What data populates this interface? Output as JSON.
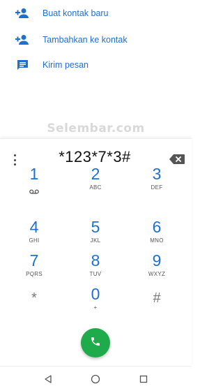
{
  "quick_actions": [
    {
      "label": "Buat kontak baru",
      "icon": "add-contact-icon"
    },
    {
      "label": "Tambahkan ke kontak",
      "icon": "add-contact-icon"
    },
    {
      "label": "Kirim pesan",
      "icon": "message-icon"
    }
  ],
  "watermark": "Selembar.com",
  "dialer": {
    "number": "*123*7*3#",
    "keys": [
      {
        "digit": "1",
        "sub": ""
      },
      {
        "digit": "2",
        "sub": "ABC"
      },
      {
        "digit": "3",
        "sub": "DEF"
      },
      {
        "digit": "4",
        "sub": "GHI"
      },
      {
        "digit": "5",
        "sub": "JKL"
      },
      {
        "digit": "6",
        "sub": "MNO"
      },
      {
        "digit": "7",
        "sub": "PQRS"
      },
      {
        "digit": "8",
        "sub": "TUV"
      },
      {
        "digit": "9",
        "sub": "WXYZ"
      },
      {
        "digit": "*",
        "sub": ""
      },
      {
        "digit": "0",
        "sub": "+"
      },
      {
        "digit": "#",
        "sub": ""
      }
    ]
  },
  "colors": {
    "accent": "#1e6fd0",
    "call": "#1faa4b"
  }
}
